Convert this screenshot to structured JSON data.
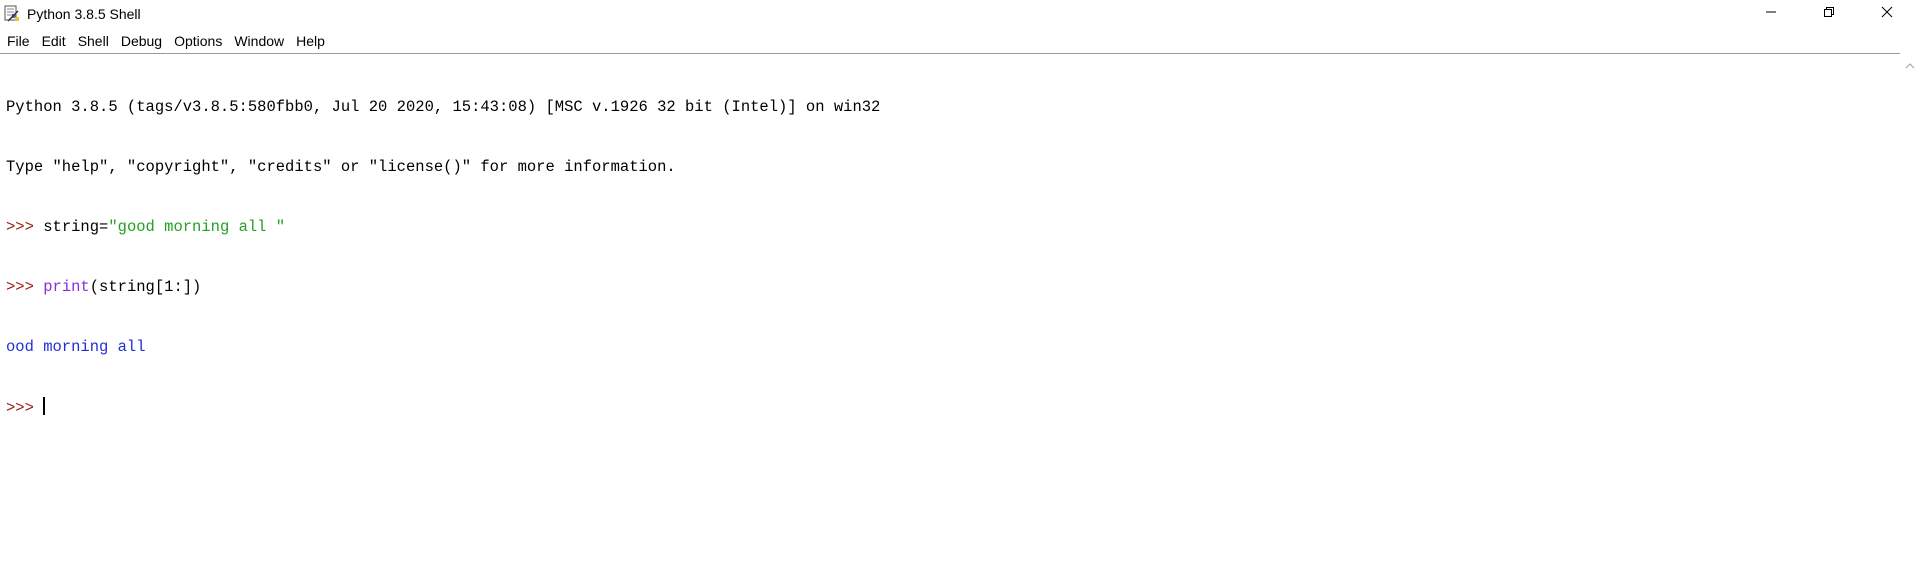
{
  "window": {
    "title": "Python 3.8.5 Shell",
    "icon": "python-idle-icon"
  },
  "menu": {
    "items": [
      "File",
      "Edit",
      "Shell",
      "Debug",
      "Options",
      "Window",
      "Help"
    ]
  },
  "shell": {
    "banner_line1": "Python 3.8.5 (tags/v3.8.5:580fbb0, Jul 20 2020, 15:43:08) [MSC v.1926 32 bit (Intel)] on win32",
    "banner_line2": "Type \"help\", \"copyright\", \"credits\" or \"license()\" for more information.",
    "prompt": ">>> ",
    "cmd1_pre": "string=",
    "cmd1_str": "\"good morning all \"",
    "cmd2_builtin": "print",
    "cmd2_rest": "(string[1:])",
    "output1": "ood morning all"
  },
  "colors": {
    "prompt": "#9b1b14",
    "string": "#23a123",
    "builtin": "#8a2be2",
    "stdout": "#1f2fd6"
  }
}
